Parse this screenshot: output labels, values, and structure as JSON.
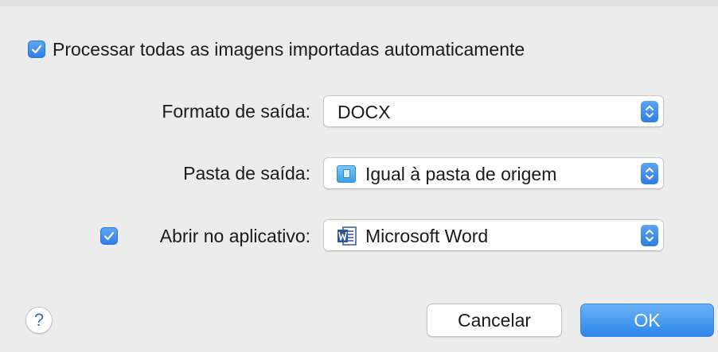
{
  "process_all": {
    "label": "Processar todas as imagens importadas automaticamente",
    "checked": true
  },
  "output_format": {
    "label": "Formato de saída:",
    "value": "DOCX",
    "icon": "stepper-icon"
  },
  "output_folder": {
    "label": "Pasta de saída:",
    "value": "Igual à pasta de origem",
    "icon": "folder-icon"
  },
  "open_in_app": {
    "label": "Abrir no aplicativo:",
    "value": "Microsoft Word",
    "checked": true,
    "icon": "word-icon"
  },
  "help": {
    "label": "?"
  },
  "buttons": {
    "cancel": "Cancelar",
    "ok": "OK"
  },
  "colors": {
    "accent": "#2f7fe6",
    "background": "#ececec"
  }
}
